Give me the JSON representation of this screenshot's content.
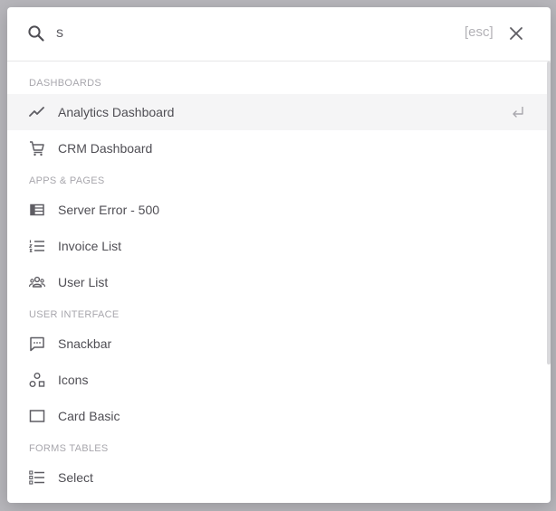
{
  "search": {
    "value": "s",
    "esc_label": "[esc]"
  },
  "sections": [
    {
      "title": "DASHBOARDS",
      "items": [
        {
          "label": "Analytics Dashboard",
          "icon": "trending-up-icon",
          "active": true
        },
        {
          "label": "CRM Dashboard",
          "icon": "cart-icon"
        }
      ]
    },
    {
      "title": "APPS & PAGES",
      "items": [
        {
          "label": "Server Error - 500",
          "icon": "table-icon"
        },
        {
          "label": "Invoice List",
          "icon": "numbered-list-icon"
        },
        {
          "label": "User List",
          "icon": "users-icon"
        }
      ]
    },
    {
      "title": "USER INTERFACE",
      "items": [
        {
          "label": "Snackbar",
          "icon": "message-icon"
        },
        {
          "label": "Icons",
          "icon": "shapes-icon"
        },
        {
          "label": "Card Basic",
          "icon": "rectangle-icon"
        }
      ]
    },
    {
      "title": "FORMS TABLES",
      "items": [
        {
          "label": "Select",
          "icon": "checklist-icon"
        }
      ]
    }
  ],
  "colors": {
    "text": "#4f4e54",
    "muted": "#a8a7ad",
    "icon": "#5e5d63",
    "active_bg": "#f5f5f6"
  }
}
